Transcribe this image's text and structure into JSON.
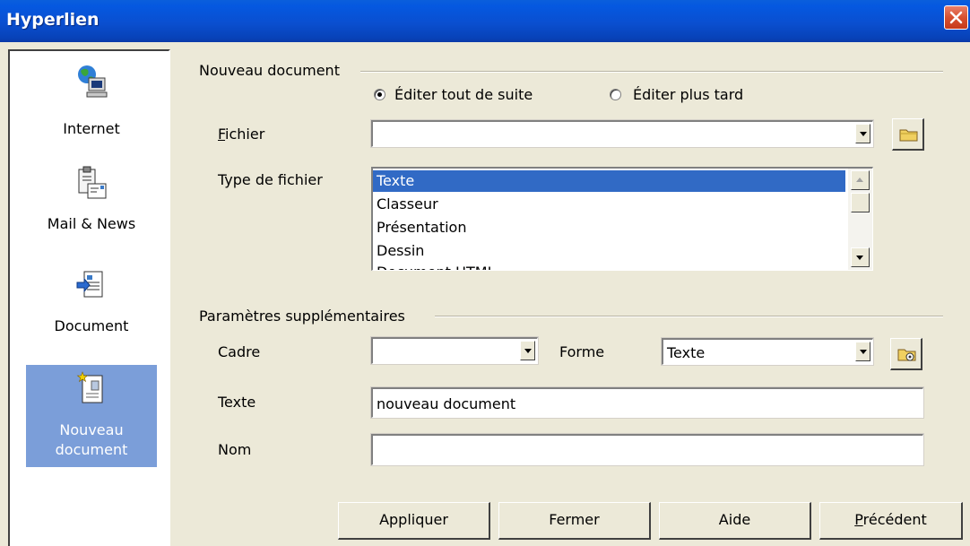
{
  "window": {
    "title": "Hyperlien"
  },
  "sidebar": {
    "items": [
      {
        "label": "Internet",
        "icon": "globe-computer-icon",
        "selected": false
      },
      {
        "label": "Mail & News",
        "icon": "mail-clipboard-icon",
        "selected": false
      },
      {
        "label": "Document",
        "icon": "document-icon",
        "selected": false
      },
      {
        "label": "Nouveau\ndocument",
        "label_line1": "Nouveau",
        "label_line2": "document",
        "icon": "new-document-icon",
        "selected": true
      }
    ]
  },
  "new_document": {
    "group_title": "Nouveau document",
    "edit_now": "Éditer tout de suite",
    "edit_later": "Éditer plus tard",
    "edit_mode_selected": "edit_now",
    "file_label": "Fichier",
    "file_value": "",
    "file_type_label": "Type de fichier",
    "file_types": [
      "Texte",
      "Classeur",
      "Présentation",
      "Dessin",
      "Document HTML"
    ],
    "selected_file_type": "Texte"
  },
  "extra": {
    "group_title": "Paramètres supplémentaires",
    "frame_label": "Cadre",
    "frame_value": "",
    "form_label": "Forme",
    "form_value": "Texte",
    "text_label": "Texte",
    "text_value": "nouveau document",
    "name_label": "Nom",
    "name_value": ""
  },
  "buttons": {
    "apply": "Appliquer",
    "close": "Fermer",
    "help": "Aide",
    "previous": "Précédent"
  },
  "colors": {
    "titlebar": "#0a4fd0",
    "selection": "#316ac5",
    "sidebar_selected": "#7b9ed9",
    "dialog_bg": "#ece9d8"
  }
}
